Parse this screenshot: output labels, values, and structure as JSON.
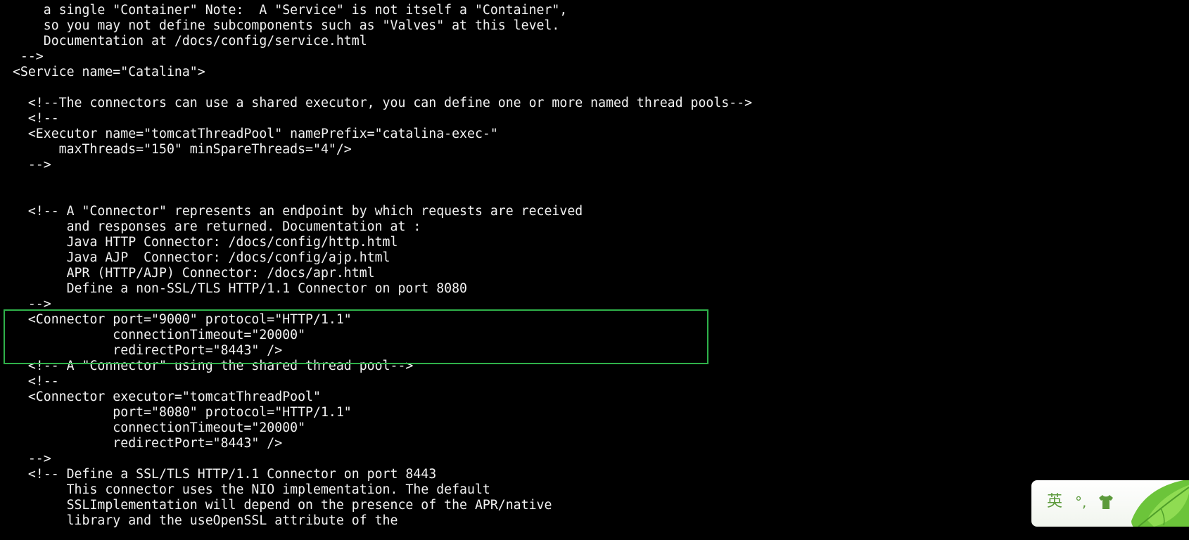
{
  "terminal": {
    "lines": [
      "     a single \"Container\" Note:  A \"Service\" is not itself a \"Container\",",
      "     so you may not define subcomponents such as \"Valves\" at this level.",
      "     Documentation at /docs/config/service.html",
      "  -->",
      " <Service name=\"Catalina\">",
      "",
      "   <!--The connectors can use a shared executor, you can define one or more named thread pools-->",
      "   <!--",
      "   <Executor name=\"tomcatThreadPool\" namePrefix=\"catalina-exec-\"",
      "       maxThreads=\"150\" minSpareThreads=\"4\"/>",
      "   -->",
      "",
      "",
      "   <!-- A \"Connector\" represents an endpoint by which requests are received",
      "        and responses are returned. Documentation at :",
      "        Java HTTP Connector: /docs/config/http.html",
      "        Java AJP  Connector: /docs/config/ajp.html",
      "        APR (HTTP/AJP) Connector: /docs/apr.html",
      "        Define a non-SSL/TLS HTTP/1.1 Connector on port 8080",
      "   -->",
      "   <Connector port=\"9000\" protocol=\"HTTP/1.1\"",
      "              connectionTimeout=\"20000\"",
      "              redirectPort=\"8443\" />",
      "   <!-- A \"Connector\" using the shared thread pool-->",
      "   <!--",
      "   <Connector executor=\"tomcatThreadPool\"",
      "              port=\"8080\" protocol=\"HTTP/1.1\"",
      "              connectionTimeout=\"20000\"",
      "              redirectPort=\"8443\" />",
      "   -->",
      "   <!-- Define a SSL/TLS HTTP/1.1 Connector on port 8443",
      "        This connector uses the NIO implementation. The default",
      "        SSLImplementation will depend on the presence of the APR/native",
      "        library and the useOpenSSL attribute of the"
    ]
  },
  "highlight": {
    "color": "#2fb14a"
  },
  "ime": {
    "language": "英",
    "punctuation": "°,",
    "icons": [
      "skin-shirt-icon",
      "leaf-icon"
    ],
    "accent_color": "#5c9a3c"
  },
  "colors": {
    "background": "#000000",
    "text": "#f2f2f2"
  }
}
